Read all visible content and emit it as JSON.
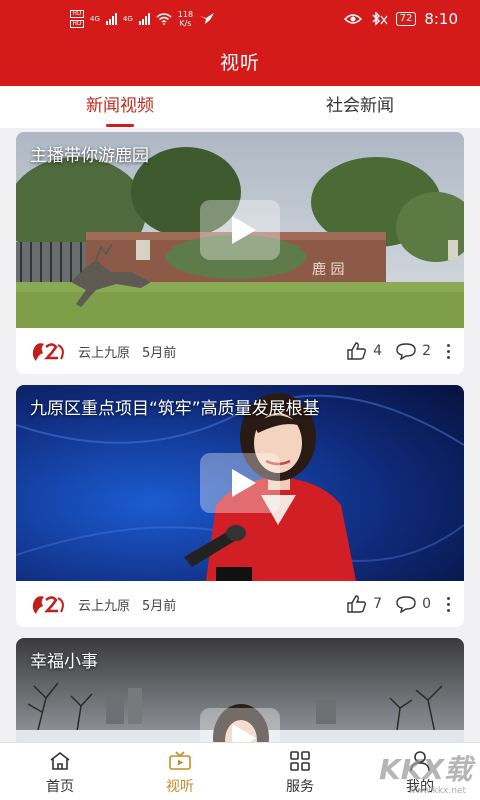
{
  "status_bar": {
    "sim1": "HD",
    "sim2": "HD",
    "net1": "4G",
    "net2": "4G",
    "speed_value": "118",
    "speed_unit": "K/s",
    "battery": "72",
    "time": "8:10"
  },
  "header": {
    "title": "视听"
  },
  "tabs": [
    {
      "label": "新闻视频",
      "active": true
    },
    {
      "label": "社会新闻",
      "active": false
    }
  ],
  "cards": [
    {
      "title": "主播带你游鹿园",
      "source": "云上九原",
      "time": "5月前",
      "likes": "4",
      "comments": "2",
      "sign_text": "鹿  园"
    },
    {
      "title": "九原区重点项目“筑牢”高质量发展根基",
      "source": "云上九原",
      "time": "5月前",
      "likes": "7",
      "comments": "0"
    },
    {
      "title": "幸福小事"
    }
  ],
  "bottom_nav": [
    {
      "label": "首页",
      "icon": "home-icon",
      "active": false
    },
    {
      "label": "视听",
      "icon": "video-icon",
      "active": true
    },
    {
      "label": "服务",
      "icon": "grid-icon",
      "active": false
    },
    {
      "label": "我的",
      "icon": "user-icon",
      "active": false
    }
  ],
  "watermark": {
    "text": "KKX载",
    "url": "www.kkx.net"
  },
  "colors": {
    "brand": "#d51b19",
    "active_nav": "#c98a2b",
    "active_tab": "#c22a1e"
  }
}
